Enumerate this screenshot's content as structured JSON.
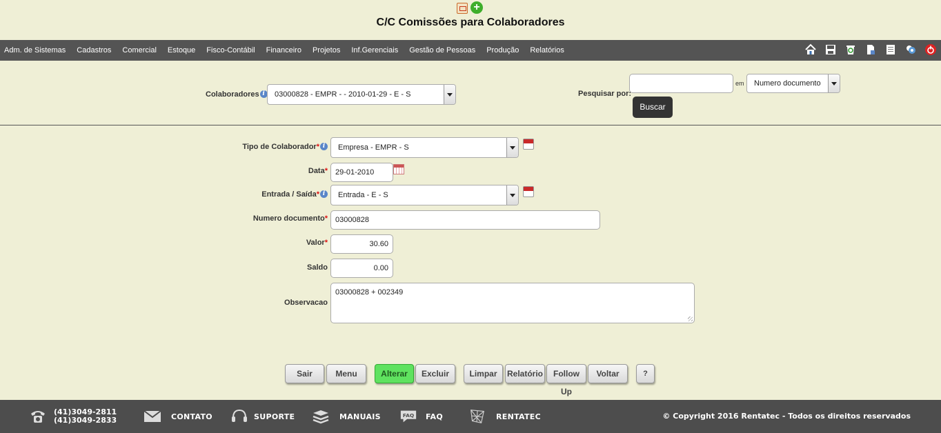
{
  "title": "C/C Comissões para Colaboradores",
  "topbar_icons": [
    "pdf-icon",
    "add-icon"
  ],
  "menu": [
    "Adm. de Sistemas",
    "Cadastros",
    "Comercial",
    "Estoque",
    "Fisco-Contábil",
    "Financeiro",
    "Projetos",
    "Inf.Gerenciais",
    "Gestão de Pessoas",
    "Produção",
    "Relatórios"
  ],
  "toolbar_icons": [
    "home-icon",
    "save-icon",
    "recycle-icon",
    "document-icon",
    "list-icon",
    "users-icon",
    "power-icon"
  ],
  "filter": {
    "colaboradores_label": "Colaboradores",
    "colaboradores_value": "03000828 - EMPR - - 2010-01-29 - E - S",
    "pesquisar_label": "Pesquisar por:",
    "search_value": "",
    "em_label": "em",
    "search_field": "Numero documento",
    "buscar_label": "Buscar"
  },
  "form": {
    "tipo_label": "Tipo de Colaborador",
    "tipo_value": "Empresa - EMPR - S",
    "data_label": "Data",
    "data_value": "29-01-2010",
    "entrada_label": "Entrada / Saída",
    "entrada_value": "Entrada - E - S",
    "numero_label": "Numero documento",
    "numero_value": "03000828",
    "valor_label": "Valor",
    "valor_value": "30.60",
    "saldo_label": "Saldo",
    "saldo_value": "0.00",
    "obs_label": "Observacao",
    "obs_value": "03000828 + 002349",
    "required_mark": "*"
  },
  "buttons": {
    "sair": "Sair",
    "menu": "Menu",
    "alterar": "Alterar",
    "excluir": "Excluir",
    "limpar": "Limpar",
    "relatorio": "Relatório",
    "followup": "Follow Up",
    "voltar": "Voltar",
    "help": "?"
  },
  "footer": {
    "phone1": "(41)3049-2811",
    "phone2": "(41)3049-2833",
    "contato": "CONTATO",
    "suporte": "SUPORTE",
    "manuais": "MANUAIS",
    "faq": "FAQ",
    "rentatec": "RENTATEC",
    "copyright": "© Copyright 2016 Rentatec - Todos os direitos reservados"
  },
  "colors": {
    "background": "#efefd6",
    "menubar": "#545454",
    "footer": "#4d4d4d",
    "primary_button": "#5fe25f",
    "required": "#dd1111"
  }
}
